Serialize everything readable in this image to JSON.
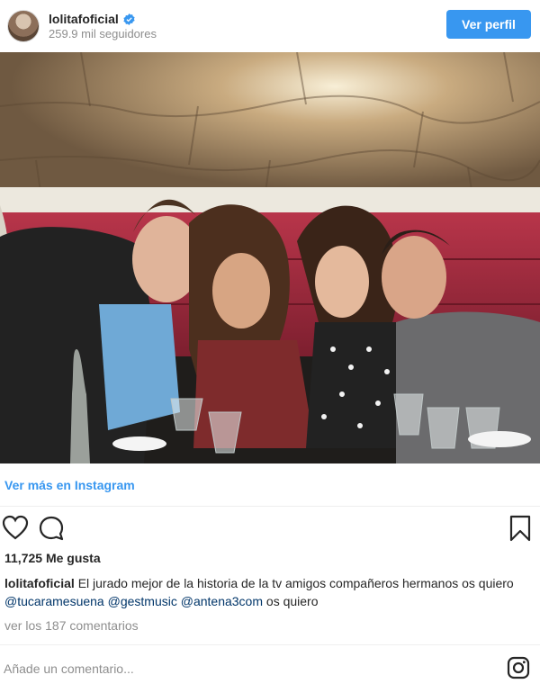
{
  "header": {
    "username": "lolitafoficial",
    "followers": "259.9 mil seguidores",
    "profile_button": "Ver perfil"
  },
  "post": {
    "more_link": "Ver más en Instagram",
    "likes": "11,725 Me gusta",
    "caption": {
      "username": "lolitafoficial",
      "text": "El jurado mejor de la historia de la tv amigos compañeros hermanos os quiero",
      "mention_1": "@tucaramesuena",
      "mention_2": "@gestmusic",
      "mention_3": "@antena3com",
      "tail": "os quiero"
    },
    "view_comments": "ver los 187 comentarios",
    "comment_placeholder": "Añade un comentario..."
  },
  "icons": {
    "verified": "verified-badge-icon",
    "like": "heart-icon",
    "comment": "comment-icon",
    "save": "bookmark-icon",
    "brand": "instagram-icon"
  },
  "colors": {
    "accent": "#3897f0",
    "mention": "#003569",
    "muted": "#8e8e8e"
  }
}
